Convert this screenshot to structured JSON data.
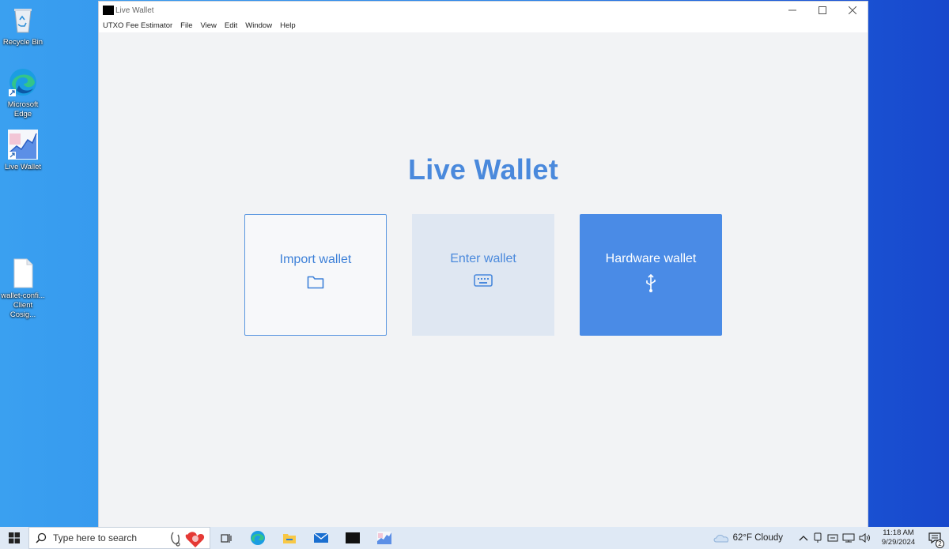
{
  "desktop": {
    "icons": [
      {
        "label": "Recycle Bin"
      },
      {
        "label": "Microsoft Edge"
      },
      {
        "label": "Live Wallet"
      },
      {
        "label": "wallet-confi... Client Cosig..."
      }
    ]
  },
  "window": {
    "title": "Live Wallet",
    "menu": [
      "UTXO Fee Estimator",
      "File",
      "View",
      "Edit",
      "Window",
      "Help"
    ],
    "heading": "Live Wallet",
    "cards": [
      {
        "label": "Import wallet",
        "icon": "folder-icon"
      },
      {
        "label": "Enter wallet",
        "icon": "keyboard-icon"
      },
      {
        "label": "Hardware wallet",
        "icon": "usb-icon"
      }
    ]
  },
  "taskbar": {
    "search_placeholder": "Type here to search",
    "weather": "62°F  Cloudy",
    "time": "11:18 AM",
    "date": "9/29/2024",
    "notifications": "2"
  },
  "colors": {
    "accent": "#4a89dc",
    "hardware_card": "#4a8be6",
    "enter_card": "#dfe7f2"
  }
}
